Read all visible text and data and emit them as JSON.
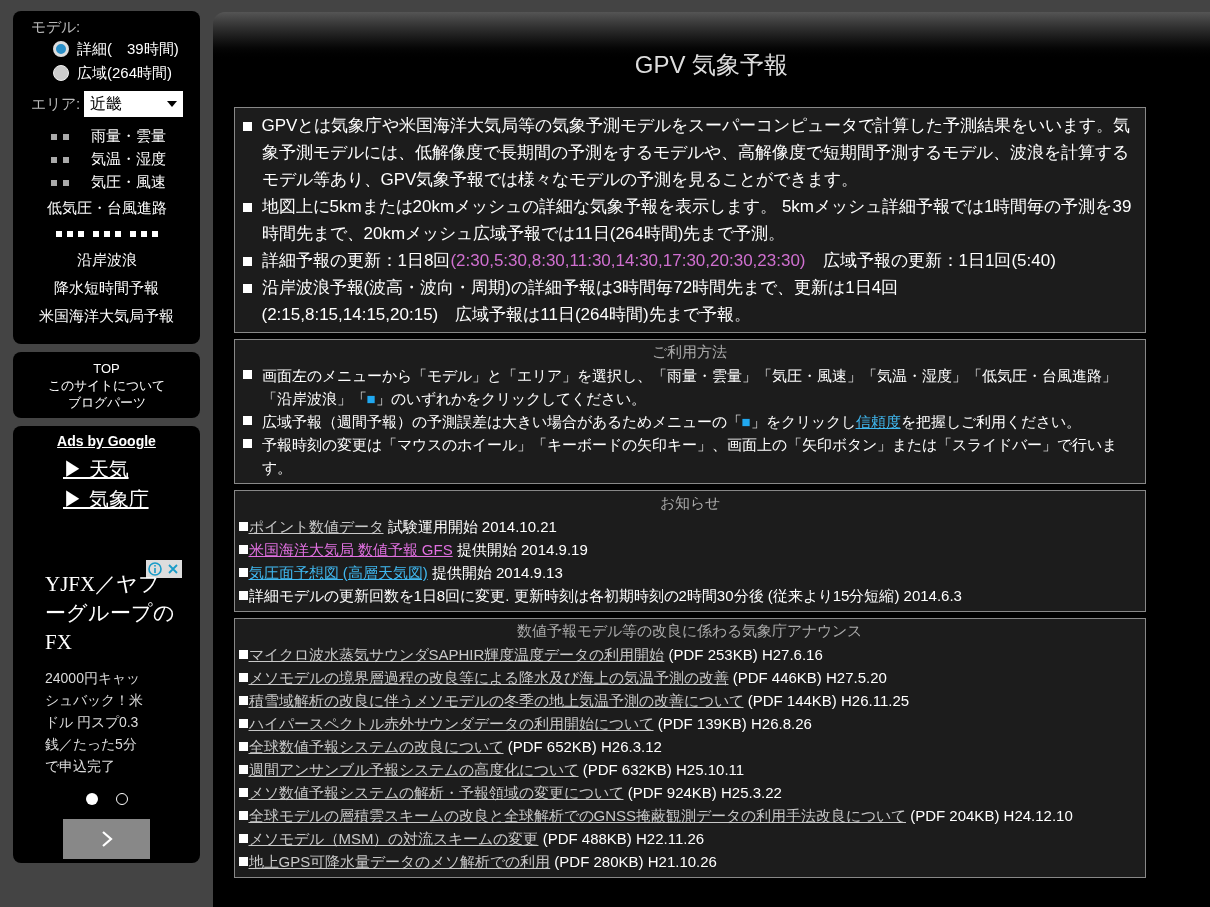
{
  "sidebar": {
    "model_label": "モデル:",
    "models": [
      {
        "label": "詳細(　39時間)",
        "selected": true
      },
      {
        "label": "広域(264時間)",
        "selected": false
      }
    ],
    "area_label": "エリア:",
    "area_value": "近畿",
    "menu": [
      {
        "kind": "squares",
        "label": "雨量・雲量"
      },
      {
        "kind": "squares",
        "label": "気温・湿度"
      },
      {
        "kind": "squares",
        "label": "気圧・風速"
      },
      {
        "kind": "plain",
        "label": "低気圧・台風進路"
      },
      {
        "kind": "square_row"
      },
      {
        "kind": "plain",
        "label": "沿岸波浪"
      },
      {
        "kind": "plain",
        "label": "降水短時間予報"
      },
      {
        "kind": "plain",
        "label": "米国海洋大気局予報"
      }
    ],
    "site_links": [
      "TOP",
      "このサイトについて",
      "ブログパーツ"
    ]
  },
  "ads": {
    "header": "Ads by Google",
    "links": [
      "▶ 天気",
      "▶ 気象庁"
    ],
    "ad_title": "YJFX／ヤフーグループのFX",
    "ad_text": "24000円キャッシュバック！米ドル 円スプ0.3銭／たった5分で申込完了",
    "dots": [
      {
        "selected": true
      },
      {
        "selected": false
      }
    ]
  },
  "title": "GPV 気象予報",
  "info": [
    [
      {
        "kind": "plain",
        "text": "GPVとは気象庁や米国海洋大気局等の気象予測モデルをスーパーコンピュータで計算した予測結果をいいます。気象予測モデルには、低解像度で長期間の予測をするモデルや、高解像度で短期間予測するモデル、波浪を計算するモデル等あり、GPV気象予報では様々なモデルの予測を見ることができます。"
      }
    ],
    [
      {
        "kind": "plain",
        "text": "地図上に5kmまたは20kmメッシュの詳細な気象予報を表示します。 5kmメッシュ詳細予報では1時間毎の予測を39時間先まで、20kmメッシュ広域予報では11日(264時間)先まで予測。"
      }
    ],
    [
      {
        "kind": "plain",
        "text": "詳細予報の更新：1日8回"
      },
      {
        "kind": "highlight",
        "text": "(2:30,5:30,8:30,11:30,14:30,17:30,20:30,23:30)"
      },
      {
        "kind": "plain",
        "text": "　広域予報の更新：1日1回(5:40)"
      }
    ],
    [
      {
        "kind": "plain",
        "text": "沿岸波浪予報(波高・波向・周期)の詳細予報は3時間毎72時間先まで、更新は1日4回"
      },
      {
        "kind": "break"
      },
      {
        "kind": "plain",
        "text": "(2:15,8:15,14:15,20:15)　広域予報は11日(264時間)先まで予報。"
      }
    ]
  ],
  "usage": {
    "heading": "ご利用方法",
    "items": [
      [
        {
          "kind": "plain",
          "text": "画面左のメニューから「モデル」と「エリア」を選択し、「雨量・雲量」「気圧・風速」「気温・湿度」「低気圧・台風進路」「沿岸波浪」「"
        },
        {
          "kind": "accent",
          "text": "■"
        },
        {
          "kind": "plain",
          "text": "」のいずれかをクリックしてください。"
        }
      ],
      [
        {
          "kind": "plain",
          "text": "広域予報（週間予報）の予測誤差は大きい場合があるためメニューの「"
        },
        {
          "kind": "accent",
          "text": "■"
        },
        {
          "kind": "plain",
          "text": "」をクリックし"
        },
        {
          "kind": "link",
          "text": "信頼度"
        },
        {
          "kind": "plain",
          "text": "を把握しご利用ください。"
        }
      ],
      [
        {
          "kind": "plain",
          "text": "予報時刻の変更は「マウスのホイール」「キーボードの矢印キー」、画面上の「矢印ボタン」または「スライドバー」で行います。"
        }
      ]
    ]
  },
  "news": {
    "heading": "お知らせ",
    "items": [
      {
        "link": "ポイント数値データ",
        "color": "#c8c8c8",
        "text": " 試験運用開始 2014.10.21"
      },
      {
        "link": "米国海洋大気局 数値予報 GFS",
        "color": "#e070e0",
        "text": " 提供開始 2014.9.19"
      },
      {
        "link": "気圧面予想図 (高層天気図)",
        "color": "#40b8f0",
        "text": " 提供開始 2014.9.13"
      },
      {
        "text": "詳細モデルの更新回数を1日8回に変更. 更新時刻は各初期時刻の2時間30分後 (従来より15分短縮) 2014.6.3"
      }
    ]
  },
  "announce": {
    "heading": "数値予報モデル等の改良に係わる気象庁アナウンス",
    "items": [
      {
        "link": "マイクロ波水蒸気サウンダSAPHIR輝度温度データの利用開始",
        "text": " (PDF 253KB) H27.6.16"
      },
      {
        "link": "メソモデルの境界層過程の改良等による降水及び海上の気温予測の改善",
        "text": " (PDF 446KB) H27.5.20"
      },
      {
        "link": "積雪域解析の改良に伴うメソモデルの冬季の地上気温予測の改善について",
        "text": " (PDF 144KB) H26.11.25"
      },
      {
        "link": "ハイパースペクトル赤外サウンダデータの利用開始について",
        "text": " (PDF 139KB) H26.8.26"
      },
      {
        "link": "全球数値予報システムの改良について",
        "text": " (PDF 652KB) H26.3.12"
      },
      {
        "link": "週間アンサンブル予報システムの高度化について",
        "text": " (PDF 632KB) H25.10.11"
      },
      {
        "link": "メソ数値予報システムの解析・予報領域の変更について",
        "text": " (PDF 924KB) H25.3.22"
      },
      {
        "link": "全球モデルの層積雲スキームの改良と全球解析でのGNSS掩蔽観測データの利用手法改良について",
        "text": " (PDF 204KB) H24.12.10"
      },
      {
        "link": "メソモデル（MSM）の対流スキームの変更",
        "text": " (PDF 488KB) H22.11.26"
      },
      {
        "link": "地上GPS可降水量データのメソ解析での利用",
        "text": " (PDF 280KB) H21.10.26"
      }
    ]
  }
}
